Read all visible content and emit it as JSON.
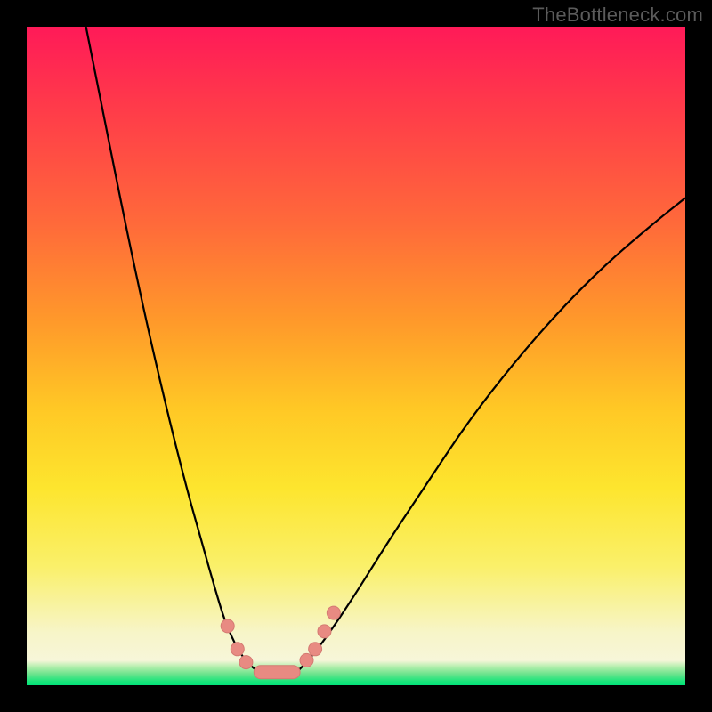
{
  "watermark": "TheBottleneck.com",
  "colors": {
    "frame_bg": "#000000",
    "gradient_top": "#ff1a58",
    "gradient_mid1": "#ff6a3a",
    "gradient_mid2": "#ffc825",
    "gradient_mid3": "#fde52e",
    "gradient_bottom": "#f7f6e8",
    "green_band": "#00e47a",
    "curve": "#000000",
    "bead": "#e88a82"
  },
  "chart_data": {
    "type": "line",
    "title": "",
    "xlabel": "",
    "ylabel": "",
    "xlim": [
      0,
      100
    ],
    "ylim": [
      0,
      100
    ],
    "grid": false,
    "legend_position": "none",
    "series": [
      {
        "name": "left-branch",
        "x": [
          9,
          12,
          15,
          18,
          21,
          24,
          26.5,
          28.5,
          30,
          31.5,
          33,
          34.5,
          35.5
        ],
        "values": [
          100,
          85,
          70,
          56,
          43,
          31,
          22,
          15,
          10,
          6.5,
          4,
          2.5,
          2
        ]
      },
      {
        "name": "right-branch",
        "x": [
          41,
          43,
          46,
          50,
          55,
          61,
          67,
          74,
          81,
          88,
          95,
          100
        ],
        "values": [
          2,
          4,
          8,
          14,
          22,
          31,
          40,
          49,
          57,
          64,
          70,
          74
        ]
      },
      {
        "name": "floor",
        "x": [
          35.5,
          41
        ],
        "values": [
          2,
          2
        ]
      }
    ],
    "annotations": [
      {
        "name": "bead",
        "x": 30.5,
        "y": 9
      },
      {
        "name": "bead",
        "x": 32.0,
        "y": 5.5
      },
      {
        "name": "bead",
        "x": 33.3,
        "y": 3.5
      },
      {
        "name": "bead-bar",
        "x0": 34.5,
        "x1": 41.5,
        "y": 2
      },
      {
        "name": "bead",
        "x": 42.5,
        "y": 3.8
      },
      {
        "name": "bead",
        "x": 43.8,
        "y": 5.5
      },
      {
        "name": "bead",
        "x": 45.2,
        "y": 8.2
      },
      {
        "name": "bead",
        "x": 46.6,
        "y": 11
      }
    ]
  }
}
